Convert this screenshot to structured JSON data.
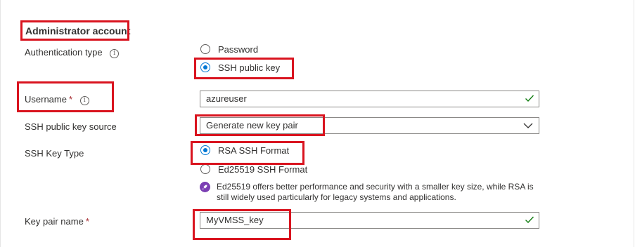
{
  "section": {
    "title": "Administrator account"
  },
  "auth_type": {
    "label": "Authentication type",
    "info_symbol": "i",
    "options": [
      {
        "label": "Password",
        "checked": false
      },
      {
        "label": "SSH public key",
        "checked": true
      }
    ]
  },
  "username": {
    "label": "Username",
    "required_mark": "*",
    "info_symbol": "i",
    "value": "azureuser"
  },
  "key_source": {
    "label": "SSH public key source",
    "selected": "Generate new key pair"
  },
  "key_type": {
    "label": "SSH Key Type",
    "options": [
      {
        "label": "RSA SSH Format",
        "checked": true
      },
      {
        "label": "Ed25519 SSH Format",
        "checked": false
      }
    ],
    "hint": "Ed25519 offers better performance and security with a smaller key size, while RSA is still widely used particularly for legacy systems and applications."
  },
  "key_pair_name": {
    "label": "Key pair name",
    "required_mark": "*",
    "value": "MyVMSS_key"
  },
  "colors": {
    "accent": "#0078d4",
    "valid_check": "#107c10",
    "required": "#a4262c",
    "highlight_box": "#d9141f",
    "hint_icon": "#7b3fb3"
  }
}
